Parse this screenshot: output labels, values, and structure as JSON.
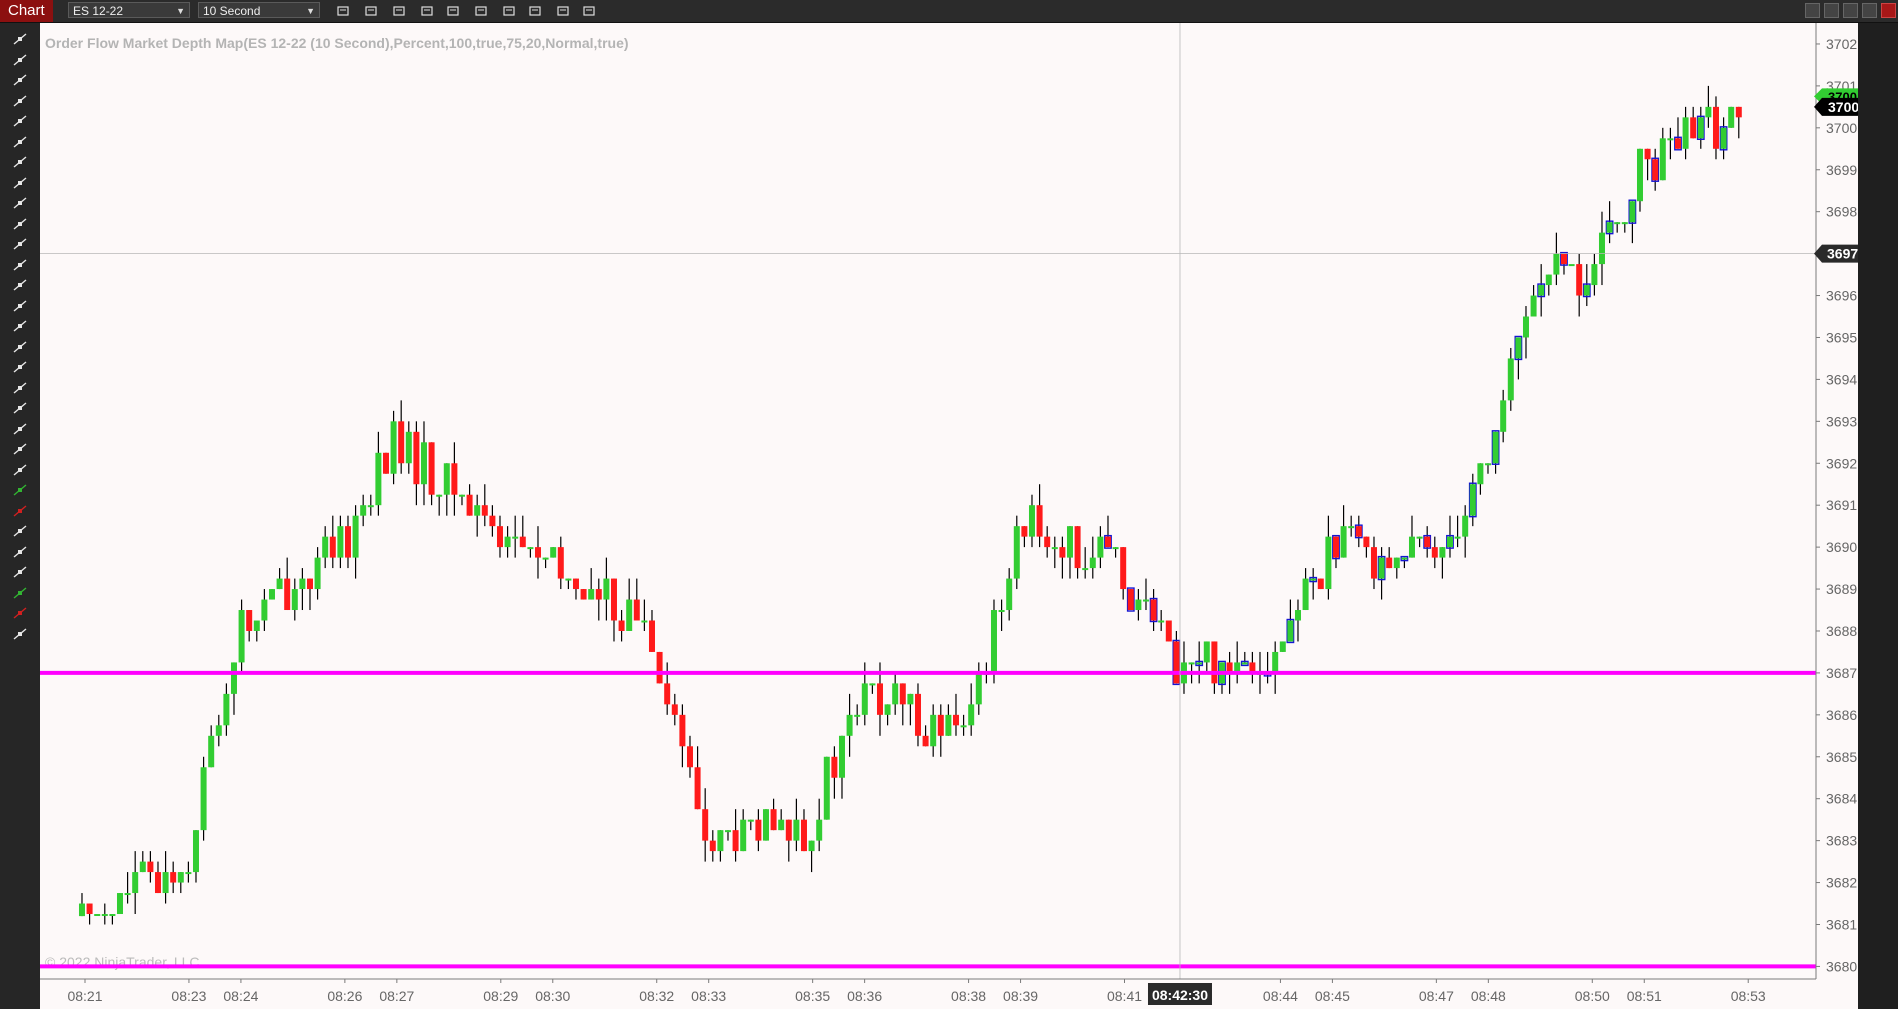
{
  "window": {
    "tab_label": "Chart"
  },
  "toolbar": {
    "instrument": "ES 12-22",
    "interval": "10 Second",
    "buttons": [
      "bars-type-icon",
      "draw-pencil-icon",
      "zoom-in-icon",
      "zoom-out-icon",
      "crosshair-icon",
      "data-box-icon",
      "properties-icon",
      "strategies-icon",
      "indicators-icon",
      "templates-icon"
    ]
  },
  "tools": [
    "lines-menu-icon",
    "ruler-icon",
    "select-icon",
    "region-icon",
    "line-icon",
    "ray-icon",
    "extended-line-icon",
    "arrow-line-icon",
    "horizontal-line-icon",
    "vertical-line-icon",
    "fib-retracement-icon",
    "fib-extension-icon",
    "fib-time-icon",
    "fib-circle-icon",
    "andrews-pitchfork-icon",
    "gann-fan-icon",
    "regression-channel-icon",
    "ellipse-icon",
    "rectangle-icon",
    "triangle-icon",
    "arc-icon",
    "path-icon",
    "arrow-up-icon",
    "arrow-down-icon",
    "diamond-icon",
    "dot-icon",
    "square-icon",
    "triangle-up-icon",
    "triangle-down-icon",
    "delete-icon"
  ],
  "indicator_label": "Order Flow Market Depth Map(ES 12-22 (10 Second),Percent,100,true,75,20,Normal,true)",
  "copyright": "© 2022 NinjaTrader, LLC",
  "colors": {
    "background": "#fdf9f9",
    "up_candle": "#32cd32",
    "down_candle": "#ff1a1a",
    "wick": "#000000",
    "level_line": "#ff00ff",
    "trail_outline": "#1414d2",
    "axis_text": "#666666"
  },
  "price_axis": {
    "ticks": [
      "3702.00",
      "3701.00",
      "3700.00",
      "3699.00",
      "3698.00",
      "3697.00",
      "3696.00",
      "3695.00",
      "3694.00",
      "3693.00",
      "3692.00",
      "3691.00",
      "3690.00",
      "3689.00",
      "3688.00",
      "3687.00",
      "3686.00",
      "3685.00",
      "3684.00",
      "3683.00",
      "3682.00",
      "3681.00",
      "3680.00"
    ],
    "crosshair_price": "3697.00",
    "last_price": "3700.50",
    "prev_marker": "3700.75"
  },
  "time_axis": {
    "ticks": [
      "08:21",
      "08:23",
      "08:24",
      "08:26",
      "08:27",
      "08:29",
      "08:30",
      "08:32",
      "08:33",
      "08:35",
      "08:36",
      "08:38",
      "08:39",
      "08:41",
      "08:44",
      "08:45",
      "08:47",
      "08:48",
      "08:50",
      "08:51",
      "08:53"
    ],
    "crosshair_time": "08:42:30"
  },
  "chart_data": {
    "type": "candlestick",
    "instrument": "ES 12-22",
    "interval": "10 Second",
    "y_range": [
      3679.7,
      3702.5
    ],
    "levels": [
      3687.0,
      3680.0
    ],
    "crosshair": {
      "time": "08:42:30",
      "price": 3697.0
    },
    "key_points": [
      {
        "time": "08:21",
        "price": 3681.2
      },
      {
        "time": "08:23",
        "price": 3682.5
      },
      {
        "time": "08:24",
        "price": 3688.0
      },
      {
        "time": "08:26",
        "price": 3690.0
      },
      {
        "time": "08:27",
        "price": 3692.5
      },
      {
        "time": "08:29",
        "price": 3690.5
      },
      {
        "time": "08:30",
        "price": 3689.5
      },
      {
        "time": "08:32",
        "price": 3688.0
      },
      {
        "time": "08:33",
        "price": 3683.0
      },
      {
        "time": "08:35",
        "price": 3683.3
      },
      {
        "time": "08:36",
        "price": 3686.5
      },
      {
        "time": "08:38",
        "price": 3685.5
      },
      {
        "time": "08:39",
        "price": 3690.5
      },
      {
        "time": "08:41",
        "price": 3689.5
      },
      {
        "time": "08:42",
        "price": 3687.2
      },
      {
        "time": "08:44",
        "price": 3687.5
      },
      {
        "time": "08:45",
        "price": 3690.0
      },
      {
        "time": "08:47",
        "price": 3689.8
      },
      {
        "time": "08:48",
        "price": 3692.0
      },
      {
        "time": "08:49",
        "price": 3696.5
      },
      {
        "time": "08:50",
        "price": 3696.3
      },
      {
        "time": "08:51",
        "price": 3699.0
      },
      {
        "time": "08:53",
        "price": 3700.5
      }
    ],
    "last": 3700.5
  }
}
